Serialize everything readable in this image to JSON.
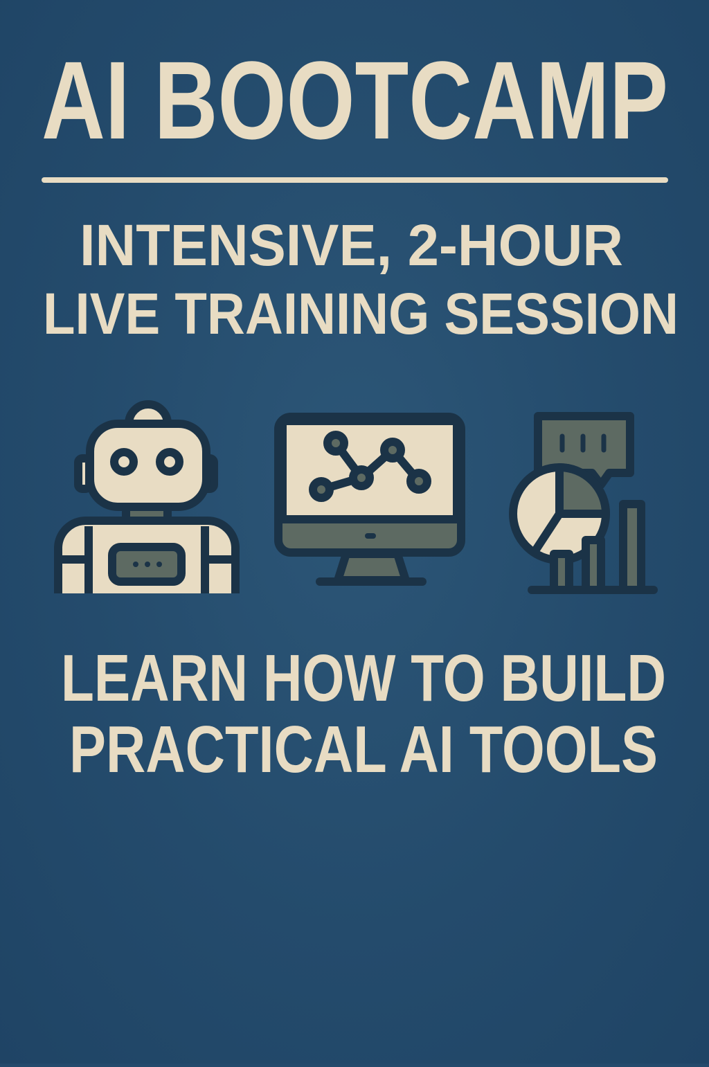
{
  "poster": {
    "title": "AI BOOTCAMP",
    "subtitle_line1": "INTENSIVE, 2-HOUR",
    "subtitle_line2": "LIVE TRAINING SESSION",
    "tagline_line1": "LEARN HOW TO BUILD",
    "tagline_line2": "PRACTICAL AI TOOLS"
  },
  "icons": [
    "robot-icon",
    "monitor-chart-icon",
    "analytics-chart-icon"
  ],
  "colors": {
    "background": "#244a6c",
    "text": "#e8dcc3",
    "outline": "#1b3347",
    "gray": "#5d6a62"
  }
}
